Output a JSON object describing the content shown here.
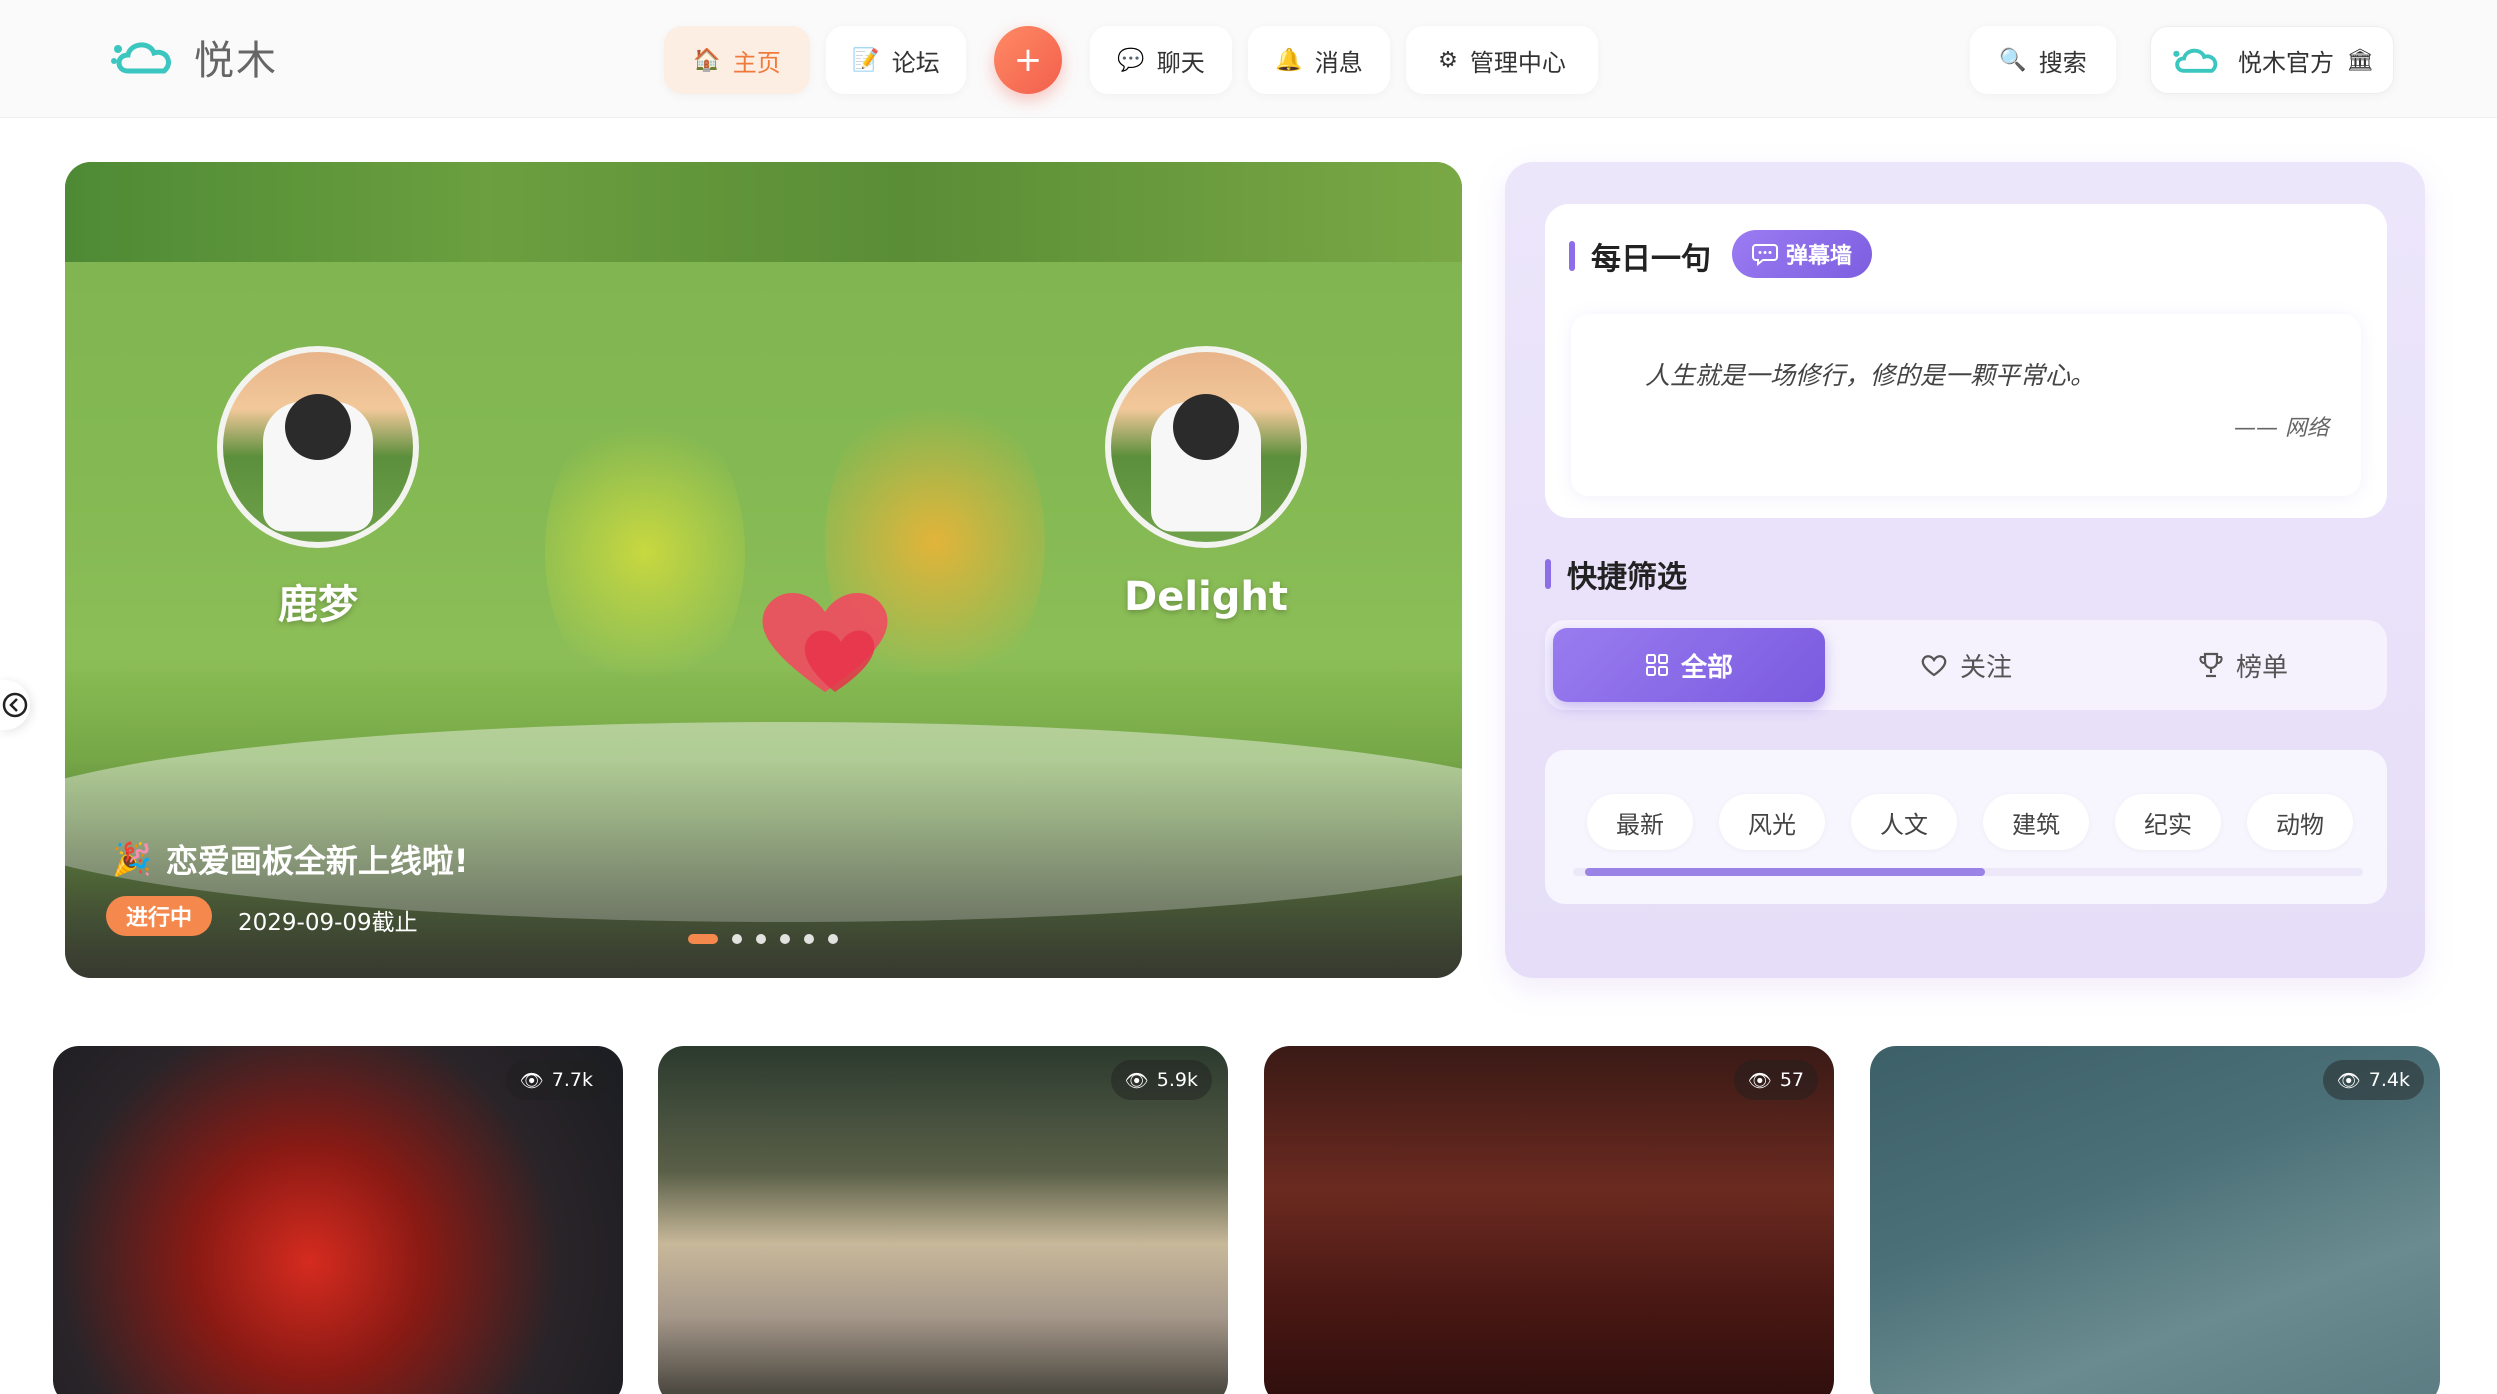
{
  "brand": {
    "name": "悦木",
    "logo_icon": "cloud-logo-icon",
    "accent": "#f07a3c",
    "purple": "#8b6ee8"
  },
  "nav": {
    "items": [
      {
        "label": "主页",
        "icon": "home-icon",
        "active": true
      },
      {
        "label": "论坛",
        "icon": "pencil-icon",
        "active": false
      },
      {
        "label": "聊天",
        "icon": "chat-bubble-icon",
        "active": false
      },
      {
        "label": "消息",
        "icon": "bell-icon",
        "active": false
      },
      {
        "label": "管理中心",
        "icon": "gear-icon",
        "active": false
      }
    ],
    "plus_label": "+",
    "search_label": "搜索",
    "account_label": "悦木官方"
  },
  "banner": {
    "left_name": "鹿梦",
    "right_name": "Delight",
    "event_title": "恋爱画板全新上线啦!",
    "status": "进行中",
    "deadline": "2029-09-09截止",
    "slide_count": 6,
    "active_slide": 0
  },
  "panel": {
    "daily_title": "每日一句",
    "danmu_label": "弹幕墙",
    "quote": "人生就是一场修行，修的是一颗平常心。",
    "quote_source": "—— 网络",
    "filter_title": "快捷筛选",
    "filter_tabs": [
      {
        "label": "全部",
        "icon": "grid-icon",
        "active": true
      },
      {
        "label": "关注",
        "icon": "heart-outline-icon",
        "active": false
      },
      {
        "label": "榜单",
        "icon": "trophy-icon",
        "active": false
      }
    ],
    "categories": [
      "最新",
      "风光",
      "人文",
      "建筑",
      "纪实",
      "动物"
    ]
  },
  "cards": [
    {
      "views": "7.7k",
      "subject": "red spider lily"
    },
    {
      "views": "5.9k",
      "subject": "lake reflection"
    },
    {
      "views": "57",
      "subject": "ancient hall figure"
    },
    {
      "views": "7.4k",
      "subject": "lotus flower"
    }
  ]
}
